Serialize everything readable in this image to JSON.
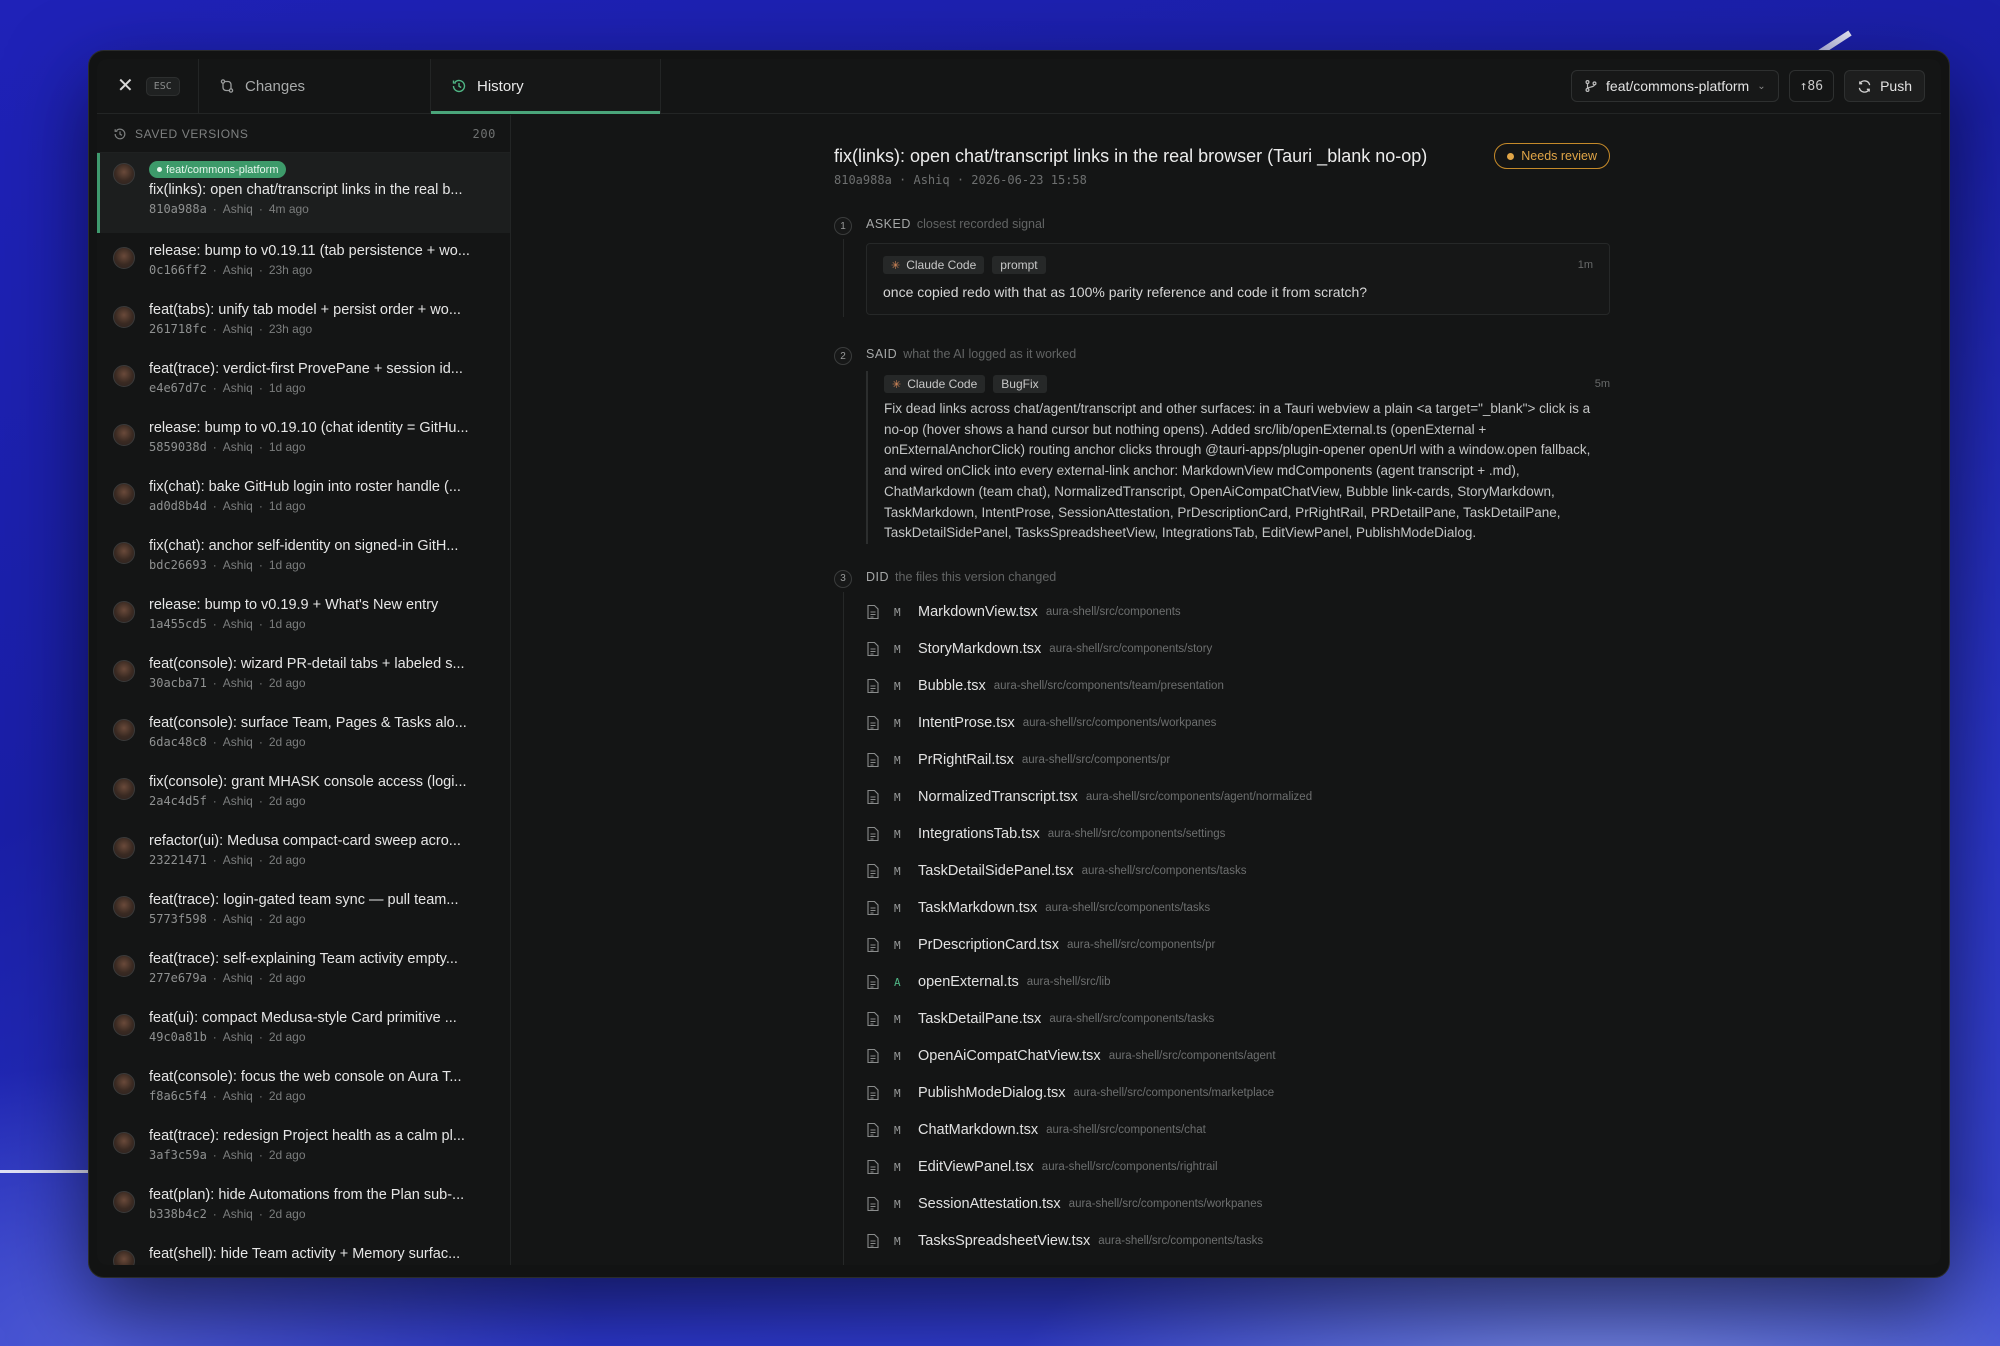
{
  "window": {
    "close_hint": "ESC",
    "tabs": [
      {
        "label": "Changes",
        "icon": "git-compare-icon"
      },
      {
        "label": "History",
        "icon": "history-icon",
        "active": true
      }
    ],
    "branch": "feat/commons-platform",
    "ahead": "↑86",
    "push_label": "Push"
  },
  "sidebar": {
    "header": "SAVED VERSIONS",
    "count": "200",
    "commits": [
      {
        "title": "fix(links): open chat/transcript links in the real b...",
        "sha": "810a988a",
        "author": "Ashiq",
        "time": "4m ago",
        "branch": "feat/commons-platform",
        "active": true
      },
      {
        "title": "release: bump to v0.19.11 (tab persistence + wo...",
        "sha": "0c166ff2",
        "author": "Ashiq",
        "time": "23h ago"
      },
      {
        "title": "feat(tabs): unify tab model + persist order + wo...",
        "sha": "261718fc",
        "author": "Ashiq",
        "time": "23h ago"
      },
      {
        "title": "feat(trace): verdict-first ProvePane + session id...",
        "sha": "e4e67d7c",
        "author": "Ashiq",
        "time": "1d ago"
      },
      {
        "title": "release: bump to v0.19.10 (chat identity = GitHu...",
        "sha": "5859038d",
        "author": "Ashiq",
        "time": "1d ago"
      },
      {
        "title": "fix(chat): bake GitHub login into roster handle (...",
        "sha": "ad0d8b4d",
        "author": "Ashiq",
        "time": "1d ago"
      },
      {
        "title": "fix(chat): anchor self-identity on signed-in GitH...",
        "sha": "bdc26693",
        "author": "Ashiq",
        "time": "1d ago"
      },
      {
        "title": "release: bump to v0.19.9 + What's New entry",
        "sha": "1a455cd5",
        "author": "Ashiq",
        "time": "1d ago"
      },
      {
        "title": "feat(console): wizard PR-detail tabs + labeled s...",
        "sha": "30acba71",
        "author": "Ashiq",
        "time": "2d ago"
      },
      {
        "title": "feat(console): surface Team, Pages & Tasks alo...",
        "sha": "6dac48c8",
        "author": "Ashiq",
        "time": "2d ago"
      },
      {
        "title": "fix(console): grant MHASK console access (logi...",
        "sha": "2a4c4d5f",
        "author": "Ashiq",
        "time": "2d ago"
      },
      {
        "title": "refactor(ui): Medusa compact-card sweep acro...",
        "sha": "23221471",
        "author": "Ashiq",
        "time": "2d ago"
      },
      {
        "title": "feat(trace): login-gated team sync — pull team...",
        "sha": "5773f598",
        "author": "Ashiq",
        "time": "2d ago"
      },
      {
        "title": "feat(trace): self-explaining Team activity empty...",
        "sha": "277e679a",
        "author": "Ashiq",
        "time": "2d ago"
      },
      {
        "title": "feat(ui): compact Medusa-style Card primitive ...",
        "sha": "49c0a81b",
        "author": "Ashiq",
        "time": "2d ago"
      },
      {
        "title": "feat(console): focus the web console on Aura T...",
        "sha": "f8a6c5f4",
        "author": "Ashiq",
        "time": "2d ago"
      },
      {
        "title": "feat(trace): redesign Project health as a calm pl...",
        "sha": "3af3c59a",
        "author": "Ashiq",
        "time": "2d ago"
      },
      {
        "title": "feat(plan): hide Automations from the Plan sub-...",
        "sha": "b338b4c2",
        "author": "Ashiq",
        "time": "2d ago"
      },
      {
        "title": "feat(shell): hide Team activity + Memory surfac...",
        "sha": "",
        "author": "",
        "time": ""
      }
    ]
  },
  "detail": {
    "title": "fix(links): open chat/transcript links in the real browser (Tauri _blank no-op)",
    "meta": "810a988a · Ashiq · 2026-06-23 15:58",
    "review": "Needs review",
    "asked": {
      "step": "1",
      "label": "ASKED",
      "sub": "closest recorded signal",
      "agent": "Claude Code",
      "kind": "prompt",
      "time": "1m",
      "text": "once copied redo with that as 100% parity reference and code it from scratch?"
    },
    "said": {
      "step": "2",
      "label": "SAID",
      "sub": "what the AI logged as it worked",
      "agent": "Claude Code",
      "kind": "BugFix",
      "time": "5m",
      "text": "Fix dead links across chat/agent/transcript and other surfaces: in a Tauri webview a plain <a target=\"_blank\"> click is a no-op (hover shows a hand cursor but nothing opens). Added src/lib/openExternal.ts (openExternal + onExternalAnchorClick) routing anchor clicks through @tauri-apps/plugin-opener openUrl with a window.open fallback, and wired onClick into every external-link anchor: MarkdownView mdComponents (agent transcript + .md), ChatMarkdown (team chat), NormalizedTranscript, OpenAiCompatChatView, Bubble link-cards, StoryMarkdown, TaskMarkdown, IntentProse, SessionAttestation, PrDescriptionCard, PrRightRail, PRDetailPane, TaskDetailPane, TaskDetailSidePanel, TasksSpreadsheetView, IntegrationsTab, EditViewPanel, PublishModeDialog."
    },
    "did": {
      "step": "3",
      "label": "DID",
      "sub": "the files this version changed",
      "files": [
        {
          "status": "M",
          "name": "MarkdownView.tsx",
          "path": "aura-shell/src/components"
        },
        {
          "status": "M",
          "name": "StoryMarkdown.tsx",
          "path": "aura-shell/src/components/story"
        },
        {
          "status": "M",
          "name": "Bubble.tsx",
          "path": "aura-shell/src/components/team/presentation"
        },
        {
          "status": "M",
          "name": "IntentProse.tsx",
          "path": "aura-shell/src/components/workpanes"
        },
        {
          "status": "M",
          "name": "PrRightRail.tsx",
          "path": "aura-shell/src/components/pr"
        },
        {
          "status": "M",
          "name": "NormalizedTranscript.tsx",
          "path": "aura-shell/src/components/agent/normalized"
        },
        {
          "status": "M",
          "name": "IntegrationsTab.tsx",
          "path": "aura-shell/src/components/settings"
        },
        {
          "status": "M",
          "name": "TaskDetailSidePanel.tsx",
          "path": "aura-shell/src/components/tasks"
        },
        {
          "status": "M",
          "name": "TaskMarkdown.tsx",
          "path": "aura-shell/src/components/tasks"
        },
        {
          "status": "M",
          "name": "PrDescriptionCard.tsx",
          "path": "aura-shell/src/components/pr"
        },
        {
          "status": "A",
          "name": "openExternal.ts",
          "path": "aura-shell/src/lib"
        },
        {
          "status": "M",
          "name": "TaskDetailPane.tsx",
          "path": "aura-shell/src/components/tasks"
        },
        {
          "status": "M",
          "name": "OpenAiCompatChatView.tsx",
          "path": "aura-shell/src/components/agent"
        },
        {
          "status": "M",
          "name": "PublishModeDialog.tsx",
          "path": "aura-shell/src/components/marketplace"
        },
        {
          "status": "M",
          "name": "ChatMarkdown.tsx",
          "path": "aura-shell/src/components/chat"
        },
        {
          "status": "M",
          "name": "EditViewPanel.tsx",
          "path": "aura-shell/src/components/rightrail"
        },
        {
          "status": "M",
          "name": "SessionAttestation.tsx",
          "path": "aura-shell/src/components/workpanes"
        },
        {
          "status": "M",
          "name": "TasksSpreadsheetView.tsx",
          "path": "aura-shell/src/components/tasks"
        }
      ]
    }
  }
}
